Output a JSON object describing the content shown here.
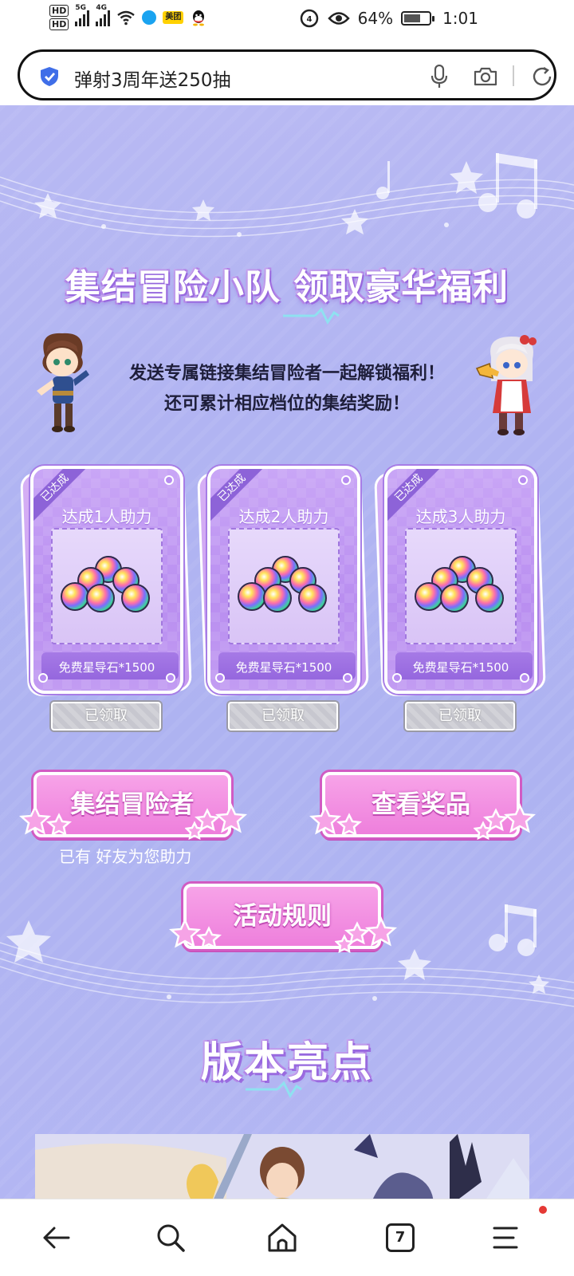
{
  "status_bar": {
    "hd1": "HD",
    "hd2": "HD",
    "net1": "5G",
    "net2": "4G",
    "meituan": "美团",
    "battery": "64%",
    "time": "1:01"
  },
  "search": {
    "query": "弹射3周年送250抽"
  },
  "page": {
    "headline": "集结冒险小队 领取豪华福利",
    "intro_line1": "发送专属链接集结冒险者一起解锁福利！",
    "intro_line2": "还可累计相应档位的集结奖励！",
    "cards": [
      {
        "badge": "已达成",
        "title": "达成1人助力",
        "prize": "免费星导石*1500",
        "status": "已领取"
      },
      {
        "badge": "已达成",
        "title": "达成2人助力",
        "prize": "免费星导石*1500",
        "status": "已领取"
      },
      {
        "badge": "已达成",
        "title": "达成3人助力",
        "prize": "免费星导石*1500",
        "status": "已领取"
      }
    ],
    "gather_button": "集结冒险者",
    "prizes_button": "查看奖品",
    "helpers_text": "已有   好友为您助力",
    "rules_button": "活动规则",
    "section_title": "版本亮点"
  },
  "navbar": {
    "tabs_count": "7"
  },
  "colors": {
    "page_bg": "#b3b6f3",
    "button_pink": "#ee7fdc",
    "card_purple": "#b98ef0"
  }
}
